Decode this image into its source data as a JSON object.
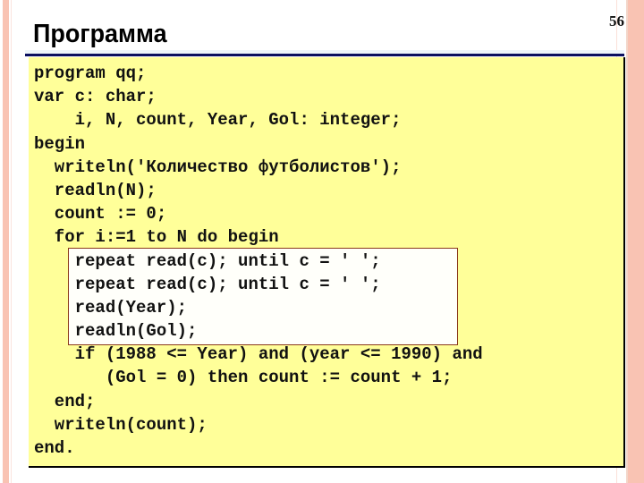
{
  "slide": {
    "title": "Программа",
    "page_number": "56",
    "colors": {
      "code_background": "#ffff99",
      "highlight_border": "#8b3a1a",
      "title_rule": "#0b1060",
      "side_stripes": "#f9c3b3"
    }
  },
  "code": {
    "language": "Pascal",
    "lines": [
      "program qq;",
      "var c: char;",
      "    i, N, count, Year, Gol: integer;",
      "begin",
      "  writeln('Количество футболистов');",
      "  readln(N);",
      "  count := 0;",
      "  for i:=1 to N do begin",
      "    repeat read(c); until c = ' ';",
      "    repeat read(c); until c = ' ';",
      "    read(Year);",
      "    readln(Gol);",
      "    if (1988 <= Year) and (year <= 1990) and",
      "       (Gol = 0) then count := count + 1;",
      "  end;",
      "  writeln(count);",
      "end."
    ],
    "highlighted_lines": [
      9,
      10,
      11,
      12
    ]
  }
}
